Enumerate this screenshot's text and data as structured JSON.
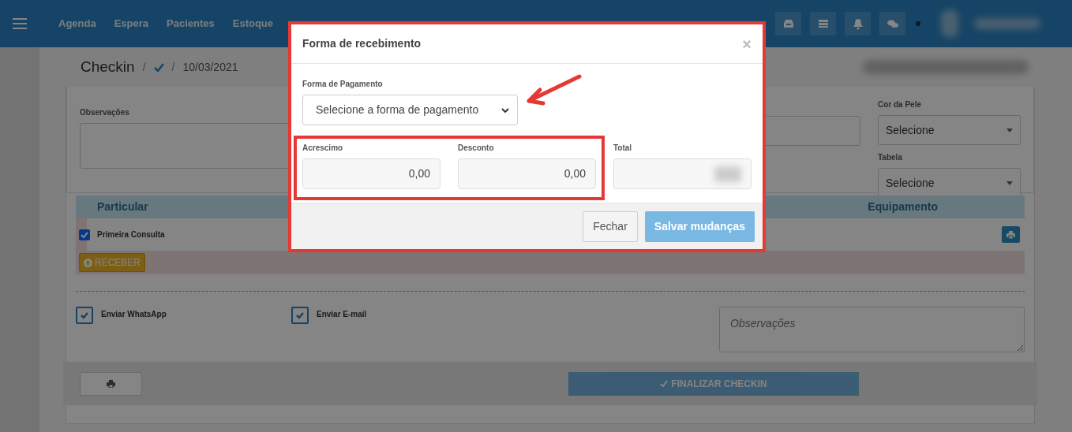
{
  "navbar": {
    "items": [
      "Agenda",
      "Espera",
      "Pacientes",
      "Estoque"
    ]
  },
  "breadcrumb": {
    "title": "Checkin",
    "separators": [
      "/",
      "/"
    ],
    "date": "10/03/2021"
  },
  "form": {
    "notes_label": "Observações",
    "skin_label": "Cor da Pele",
    "skin_value": "Selecione",
    "table_label": "Tabela",
    "table_value": "Selecione"
  },
  "procedures": {
    "columns": [
      "Particular",
      "Equipamento"
    ],
    "rows": [
      {
        "name": "Primeira Consulta",
        "checked": true
      }
    ],
    "receive_button": "RECEBER"
  },
  "notifications": [
    {
      "label": "Enviar WhatsApp",
      "checked": true
    },
    {
      "label": "Enviar E-mail",
      "checked": true
    }
  ],
  "notes": {
    "placeholder": "Observações"
  },
  "finalize_button": "FINALIZAR CHECKIN",
  "modal": {
    "title": "Forma de recebimento",
    "close": "×",
    "payment": {
      "label": "Forma de Pagamento",
      "value": "Selecione a forma de pagamento"
    },
    "fields": [
      {
        "label": "Acrescimo",
        "value": "0,00"
      },
      {
        "label": "Desconto",
        "value": "0,00"
      },
      {
        "label": "Total"
      }
    ],
    "buttons": [
      {
        "label": "Fechar",
        "kind": "secondary"
      },
      {
        "label": "Salvar mudanças",
        "kind": "primary"
      }
    ]
  }
}
